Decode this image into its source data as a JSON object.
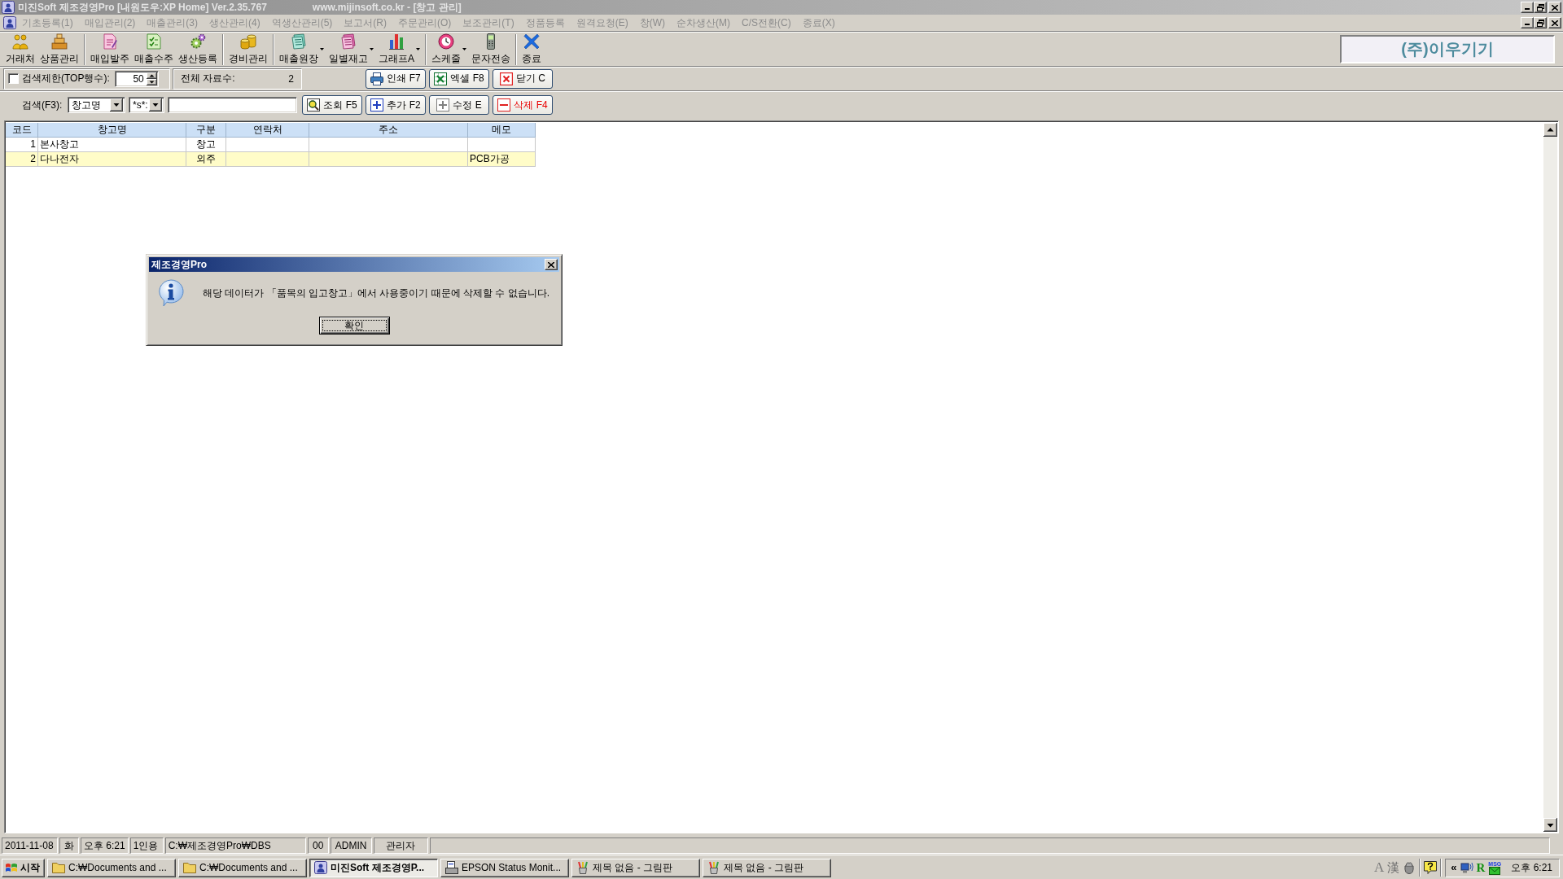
{
  "window": {
    "title": "미진Soft 제조경영Pro [내원도우:XP Home] Ver.2.35.767",
    "subtitle": "www.mijinsoft.co.kr - [창고 관리]",
    "active": false
  },
  "menu": {
    "items": [
      {
        "label": "기초등록(1)",
        "disabled": true
      },
      {
        "label": "매입관리(2)",
        "disabled": true
      },
      {
        "label": "매출관리(3)",
        "disabled": true
      },
      {
        "label": "생산관리(4)",
        "disabled": true
      },
      {
        "label": "역생산관리(5)",
        "disabled": true
      },
      {
        "label": "보고서(R)",
        "disabled": true
      },
      {
        "label": "주문관리(O)",
        "disabled": true
      },
      {
        "label": "보조관리(T)",
        "disabled": true
      },
      {
        "label": "정품등록",
        "disabled": true
      },
      {
        "label": "원격요청(E)",
        "disabled": true
      },
      {
        "label": "창(W)",
        "disabled": true
      },
      {
        "label": "순차생산(M)",
        "disabled": true
      },
      {
        "label": "C/S전환(C)",
        "disabled": true
      },
      {
        "label": "종료(X)",
        "disabled": true
      }
    ]
  },
  "toolbar": {
    "groups": [
      {
        "buttons": [
          {
            "label": "거래처",
            "dropdown": false
          },
          {
            "label": "상품관리",
            "dropdown": false
          }
        ]
      },
      {
        "buttons": [
          {
            "label": "매입발주",
            "dropdown": false
          },
          {
            "label": "매출수주",
            "dropdown": false
          },
          {
            "label": "생산등록",
            "dropdown": false
          }
        ]
      },
      {
        "buttons": [
          {
            "label": "경비관리",
            "dropdown": false
          }
        ]
      },
      {
        "buttons": [
          {
            "label": "매출원장",
            "dropdown": true
          },
          {
            "label": "일별재고",
            "dropdown": true
          },
          {
            "label": "그래프A",
            "dropdown": true
          }
        ]
      },
      {
        "buttons": [
          {
            "label": "스케줄",
            "dropdown": true
          },
          {
            "label": "문자전송",
            "dropdown": false
          }
        ]
      },
      {
        "buttons": [
          {
            "label": "종료",
            "dropdown": false
          }
        ]
      }
    ]
  },
  "company_box": {
    "name": "(주)이우기기"
  },
  "filter_bar": {
    "limit": {
      "label": "검색제한(TOP행수):",
      "checked": false,
      "value": "50"
    },
    "total": {
      "label": "전체 자료수:",
      "value": "2"
    },
    "buttons": [
      {
        "label": "인쇄 F7",
        "kind": "print"
      },
      {
        "label": "엑셀 F8",
        "kind": "excel"
      },
      {
        "label": "닫기 C",
        "kind": "close"
      }
    ]
  },
  "search_bar": {
    "label": "검색(F3):",
    "field": "창고명",
    "match": "*s*:",
    "buttons": [
      {
        "label": "조회 F5",
        "kind": "search"
      },
      {
        "label": "추가 F2",
        "kind": "add"
      },
      {
        "label": "수정 E",
        "kind": "edit"
      },
      {
        "label": "삭제 F4",
        "kind": "delete"
      }
    ]
  },
  "table": {
    "columns": [
      "코드",
      "창고명",
      "구분",
      "연락처",
      "주소",
      "메모"
    ],
    "rows": [
      {
        "code": "1",
        "name": "본사창고",
        "category": "창고",
        "selected": false
      },
      {
        "code": "2",
        "name": "다나전자",
        "category": "외주",
        "memo": "PCB가공",
        "selected": true
      }
    ]
  },
  "dialog": {
    "title": "제조경영Pro",
    "message": "해당 데이터가 「품목의 입고창고」에서 사용중이기 때문에 삭제할 수 없습니다.",
    "button": "확인"
  },
  "status_bar": {
    "cells": [
      "2011-11-08",
      "화",
      "오후 6:21",
      "1인용",
      "C:₩제조경영Pro₩DBS",
      "00",
      "ADMIN",
      "관리자"
    ]
  },
  "taskbar": {
    "start": "시작",
    "tasks": [
      {
        "label": "C:₩Documents and ...",
        "kind": "folder",
        "selected": false
      },
      {
        "label": "C:₩Documents and ...",
        "kind": "folder",
        "selected": false
      },
      {
        "label": "미진Soft 제조경영P...",
        "kind": "app",
        "selected": true
      },
      {
        "label": "EPSON Status Monit...",
        "kind": "printer",
        "selected": false
      },
      {
        "label": "제목 없음 - 그림판",
        "kind": "paint",
        "selected": false
      },
      {
        "label": "제목 없음 - 그림판",
        "kind": "paint",
        "selected": false
      }
    ],
    "language_bar": {
      "mode": "A",
      "hanja": "漢"
    },
    "tray": {
      "expand": "«",
      "icons": [
        {
          "kind": "network"
        },
        {
          "kind": "r-app",
          "label": "R"
        },
        {
          "kind": "messenger",
          "label": "MSG"
        }
      ]
    },
    "clock": "오후 6:21"
  }
}
